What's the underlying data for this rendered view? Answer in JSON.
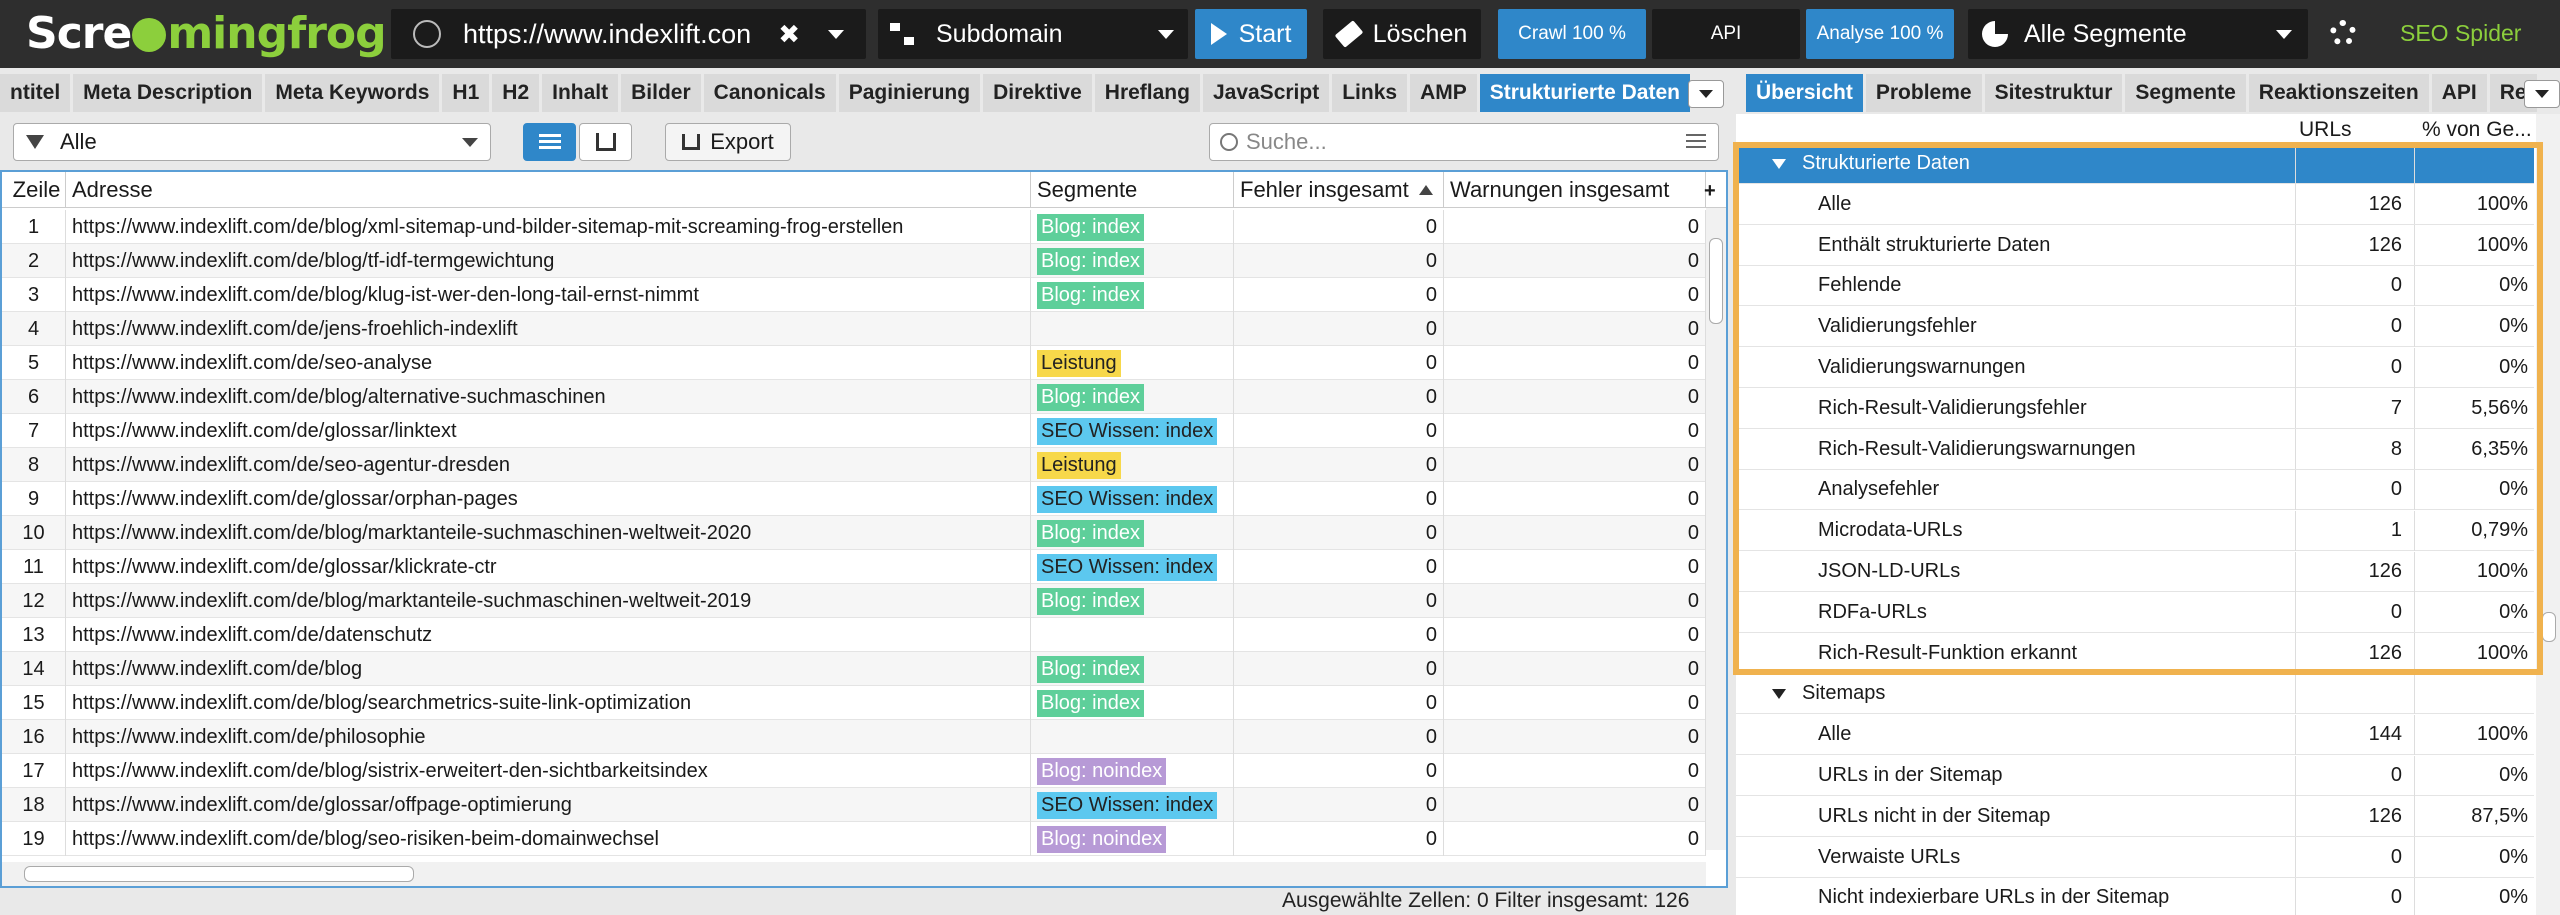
{
  "app": {
    "logo_text": "Screamingfrog",
    "brand_label": "SEO Spider"
  },
  "toolbar": {
    "url": "https://www.indexlift.con",
    "mode": "Subdomain",
    "start": "Start",
    "clear": "Löschen",
    "crawl": "Crawl 100 %",
    "api": "API",
    "analyse": "Analyse 100 %",
    "segments": "Alle Segmente"
  },
  "tabs_left": [
    "ntitel",
    "Meta Description",
    "Meta Keywords",
    "H1",
    "H2",
    "Inhalt",
    "Bilder",
    "Canonicals",
    "Paginierung",
    "Direktive",
    "Hreflang",
    "JavaScript",
    "Links",
    "AMP",
    "Strukturierte Daten"
  ],
  "tabs_left_active": "Strukturierte Daten",
  "tabs_right": [
    "Übersicht",
    "Probleme",
    "Sitestruktur",
    "Segmente",
    "Reaktionszeiten",
    "API",
    "Re"
  ],
  "tabs_right_active": "Übersicht",
  "filter": {
    "selected": "Alle",
    "export": "Export",
    "search_placeholder": "Suche..."
  },
  "table": {
    "headers": [
      "Zeile",
      "Adresse",
      "Segmente",
      "Fehler insgesamt",
      "Warnungen insgesamt"
    ],
    "rows": [
      {
        "n": "1",
        "url": "https://www.indexlift.com/de/blog/xml-sitemap-und-bilder-sitemap-mit-screaming-frog-erstellen",
        "seg": "Blog: index",
        "segcolor": "#5ecf9a",
        "err": "0",
        "warn": "0"
      },
      {
        "n": "2",
        "url": "https://www.indexlift.com/de/blog/tf-idf-termgewichtung",
        "seg": "Blog: index",
        "segcolor": "#5ecf9a",
        "err": "0",
        "warn": "0"
      },
      {
        "n": "3",
        "url": "https://www.indexlift.com/de/blog/klug-ist-wer-den-long-tail-ernst-nimmt",
        "seg": "Blog: index",
        "segcolor": "#5ecf9a",
        "err": "0",
        "warn": "0"
      },
      {
        "n": "4",
        "url": "https://www.indexlift.com/de/jens-froehlich-indexlift",
        "seg": "",
        "segcolor": "",
        "err": "0",
        "warn": "0"
      },
      {
        "n": "5",
        "url": "https://www.indexlift.com/de/seo-analyse",
        "seg": "Leistung",
        "segcolor": "#f7d84a",
        "err": "0",
        "warn": "0"
      },
      {
        "n": "6",
        "url": "https://www.indexlift.com/de/blog/alternative-suchmaschinen",
        "seg": "Blog: index",
        "segcolor": "#5ecf9a",
        "err": "0",
        "warn": "0"
      },
      {
        "n": "7",
        "url": "https://www.indexlift.com/de/glossar/linktext",
        "seg": "SEO Wissen: index",
        "segcolor": "#5cc8ef",
        "err": "0",
        "warn": "0"
      },
      {
        "n": "8",
        "url": "https://www.indexlift.com/de/seo-agentur-dresden",
        "seg": "Leistung",
        "segcolor": "#f7d84a",
        "err": "0",
        "warn": "0"
      },
      {
        "n": "9",
        "url": "https://www.indexlift.com/de/glossar/orphan-pages",
        "seg": "SEO Wissen: index",
        "segcolor": "#5cc8ef",
        "err": "0",
        "warn": "0"
      },
      {
        "n": "10",
        "url": "https://www.indexlift.com/de/blog/marktanteile-suchmaschinen-weltweit-2020",
        "seg": "Blog: index",
        "segcolor": "#5ecf9a",
        "err": "0",
        "warn": "0"
      },
      {
        "n": "11",
        "url": "https://www.indexlift.com/de/glossar/klickrate-ctr",
        "seg": "SEO Wissen: index",
        "segcolor": "#5cc8ef",
        "err": "0",
        "warn": "0"
      },
      {
        "n": "12",
        "url": "https://www.indexlift.com/de/blog/marktanteile-suchmaschinen-weltweit-2019",
        "seg": "Blog: index",
        "segcolor": "#5ecf9a",
        "err": "0",
        "warn": "0"
      },
      {
        "n": "13",
        "url": "https://www.indexlift.com/de/datenschutz",
        "seg": "",
        "segcolor": "",
        "err": "0",
        "warn": "0"
      },
      {
        "n": "14",
        "url": "https://www.indexlift.com/de/blog",
        "seg": "Blog: index",
        "segcolor": "#5ecf9a",
        "err": "0",
        "warn": "0"
      },
      {
        "n": "15",
        "url": "https://www.indexlift.com/de/blog/searchmetrics-suite-link-optimization",
        "seg": "Blog: index",
        "segcolor": "#5ecf9a",
        "err": "0",
        "warn": "0"
      },
      {
        "n": "16",
        "url": "https://www.indexlift.com/de/philosophie",
        "seg": "",
        "segcolor": "",
        "err": "0",
        "warn": "0"
      },
      {
        "n": "17",
        "url": "https://www.indexlift.com/de/blog/sistrix-erweitert-den-sichtbarkeitsindex",
        "seg": "Blog: noindex",
        "segcolor": "#b79ad6",
        "err": "0",
        "warn": "0"
      },
      {
        "n": "18",
        "url": "https://www.indexlift.com/de/glossar/offpage-optimierung",
        "seg": "SEO Wissen: index",
        "segcolor": "#5cc8ef",
        "err": "0",
        "warn": "0"
      },
      {
        "n": "19",
        "url": "https://www.indexlift.com/de/blog/seo-risiken-beim-domainwechsel",
        "seg": "Blog: noindex",
        "segcolor": "#b79ad6",
        "err": "0",
        "warn": "0"
      }
    ]
  },
  "status": "Ausgewählte Zellen:  0  Filter insgesamt:  126",
  "overview": {
    "col_urls": "URLs",
    "col_pct": "% von Ge...",
    "rows": [
      {
        "label": "Strukturierte Daten",
        "n": "",
        "p": "",
        "type": "section",
        "selected": true
      },
      {
        "label": "Alle",
        "n": "126",
        "p": "100%",
        "type": "item"
      },
      {
        "label": "Enthält strukturierte Daten",
        "n": "126",
        "p": "100%",
        "type": "item"
      },
      {
        "label": "Fehlende",
        "n": "0",
        "p": "0%",
        "type": "item"
      },
      {
        "label": "Validierungsfehler",
        "n": "0",
        "p": "0%",
        "type": "item"
      },
      {
        "label": "Validierungswarnungen",
        "n": "0",
        "p": "0%",
        "type": "item"
      },
      {
        "label": "Rich-Result-Validierungsfehler",
        "n": "7",
        "p": "5,56%",
        "type": "item"
      },
      {
        "label": "Rich-Result-Validierungswarnungen",
        "n": "8",
        "p": "6,35%",
        "type": "item"
      },
      {
        "label": "Analysefehler",
        "n": "0",
        "p": "0%",
        "type": "item"
      },
      {
        "label": "Microdata-URLs",
        "n": "1",
        "p": "0,79%",
        "type": "item"
      },
      {
        "label": "JSON-LD-URLs",
        "n": "126",
        "p": "100%",
        "type": "item"
      },
      {
        "label": "RDFa-URLs",
        "n": "0",
        "p": "0%",
        "type": "item"
      },
      {
        "label": "Rich-Result-Funktion erkannt",
        "n": "126",
        "p": "100%",
        "type": "item"
      },
      {
        "label": "Sitemaps",
        "n": "",
        "p": "",
        "type": "section"
      },
      {
        "label": "Alle",
        "n": "144",
        "p": "100%",
        "type": "item"
      },
      {
        "label": "URLs in der Sitemap",
        "n": "0",
        "p": "0%",
        "type": "item"
      },
      {
        "label": "URLs nicht in der Sitemap",
        "n": "126",
        "p": "87,5%",
        "type": "item"
      },
      {
        "label": "Verwaiste URLs",
        "n": "0",
        "p": "0%",
        "type": "item"
      },
      {
        "label": "Nicht indexierbare URLs in der Sitemap",
        "n": "0",
        "p": "0%",
        "type": "item"
      }
    ]
  },
  "colors": {
    "accent": "#2f87c9",
    "brand_green": "#8ccf3c",
    "highlight": "#f0b24e"
  }
}
